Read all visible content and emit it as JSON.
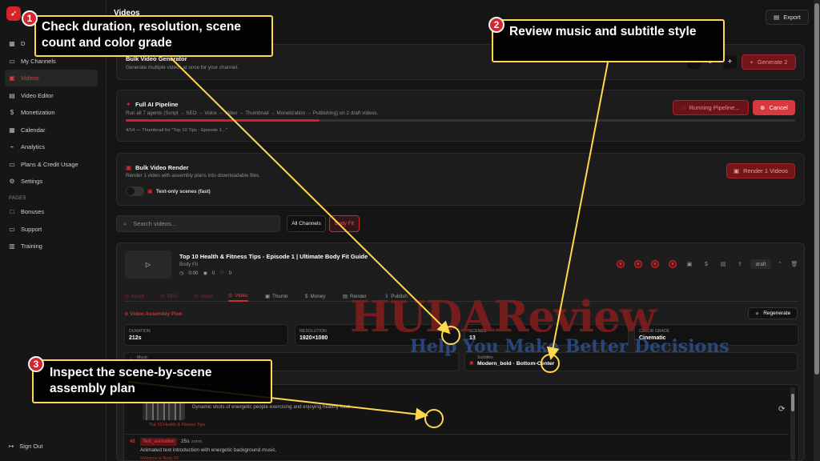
{
  "sidebar": {
    "logo_text": "...",
    "items": [
      {
        "label": "D",
        "icon": "dashboard-icon"
      },
      {
        "label": "My Channels",
        "icon": "folder-icon"
      },
      {
        "label": "Videos",
        "icon": "video-icon",
        "active": true
      },
      {
        "label": "Video Editor",
        "icon": "file-icon"
      },
      {
        "label": "Monetization",
        "icon": "dollar-icon"
      },
      {
        "label": "Calendar",
        "icon": "calendar-icon"
      },
      {
        "label": "Analytics",
        "icon": "analytics-icon"
      },
      {
        "label": "Plans & Credit Usage",
        "icon": "credit-card-icon"
      },
      {
        "label": "Settings",
        "icon": "gear-icon"
      }
    ],
    "pages_label": "PAGES",
    "page_items": [
      {
        "label": "Bonuses",
        "icon": "gift-icon"
      },
      {
        "label": "Support",
        "icon": "support-icon"
      },
      {
        "label": "Training",
        "icon": "book-icon"
      }
    ],
    "signout": "Sign Out"
  },
  "header": {
    "title": "Videos",
    "export": "Export"
  },
  "bulk_generator": {
    "title": "Bulk Video Generator",
    "desc": "Generate multiple videos at once for your channel.",
    "count": "2",
    "button": "Generate 2"
  },
  "pipeline": {
    "title": "Full AI Pipeline",
    "desc": "Run all 7 agents (Script → SEO → Voice → Video → Thumbnail → Monetization → Publishing) on 2 draft videos.",
    "status": "4/14 — Thumbnail for \"Top 10 Tips - Episode 1...\"",
    "progress": 0.29,
    "running": "Running Pipeline...",
    "cancel": "Cancel"
  },
  "bulk_render": {
    "title": "Bulk Video Render",
    "desc": "Render 1 video with assembly plans into downloadable files.",
    "toggle": "Text-only scenes (fast)",
    "button": "Render 1 Videos"
  },
  "search": {
    "placeholder": "Search videos...",
    "all": "All Channels",
    "selected": "Body Fit"
  },
  "video": {
    "title": "Top 10 Health & Fitness Tips - Episode 1 | Ultimate Body Fit Guide",
    "channel": "Body Fit",
    "duration": "0:00",
    "views": "0",
    "likes": "0",
    "status": "draft",
    "tabs": [
      "Script",
      "SEO",
      "Voice",
      "Video",
      "Thumb",
      "Money",
      "Render",
      "Publish"
    ],
    "plan_title": "Video Assembly Plan",
    "regenerate": "Regenerate",
    "stats": [
      {
        "label": "Duration",
        "value": "212s"
      },
      {
        "label": "Resolution",
        "value": "1920×1080"
      },
      {
        "label": "Scenes",
        "value": "13"
      },
      {
        "label": "Color Grade",
        "value": "Cinematic"
      }
    ],
    "music_label": "Music",
    "subtitles_label": "Subtitles",
    "subtitles_value": "Modern_bold · Bottom-Center",
    "scene1_desc": "Dynamic shots of energetic people exercising and enjoying healthy food",
    "scene1_link": "Top 10 Health & Fitness Tips",
    "scene2_num": "#2",
    "scene2_type": "Text_animation",
    "scene2_duration": "25s",
    "scene2_zoom": "zoom",
    "scene2_text": "Animated text introduction with energetic background music.",
    "scene2_link": "Welcome to Body Fit"
  },
  "callouts": [
    {
      "num": "1",
      "text": "Check duration, resolution, scene count and color grade"
    },
    {
      "num": "2",
      "text": "Review music and subtitle style"
    },
    {
      "num": "3",
      "text": "Inspect the scene-by-scene assembly plan"
    }
  ],
  "watermark": {
    "main": "HUDAReview",
    "sub": "Help You Make Better Decisions"
  }
}
